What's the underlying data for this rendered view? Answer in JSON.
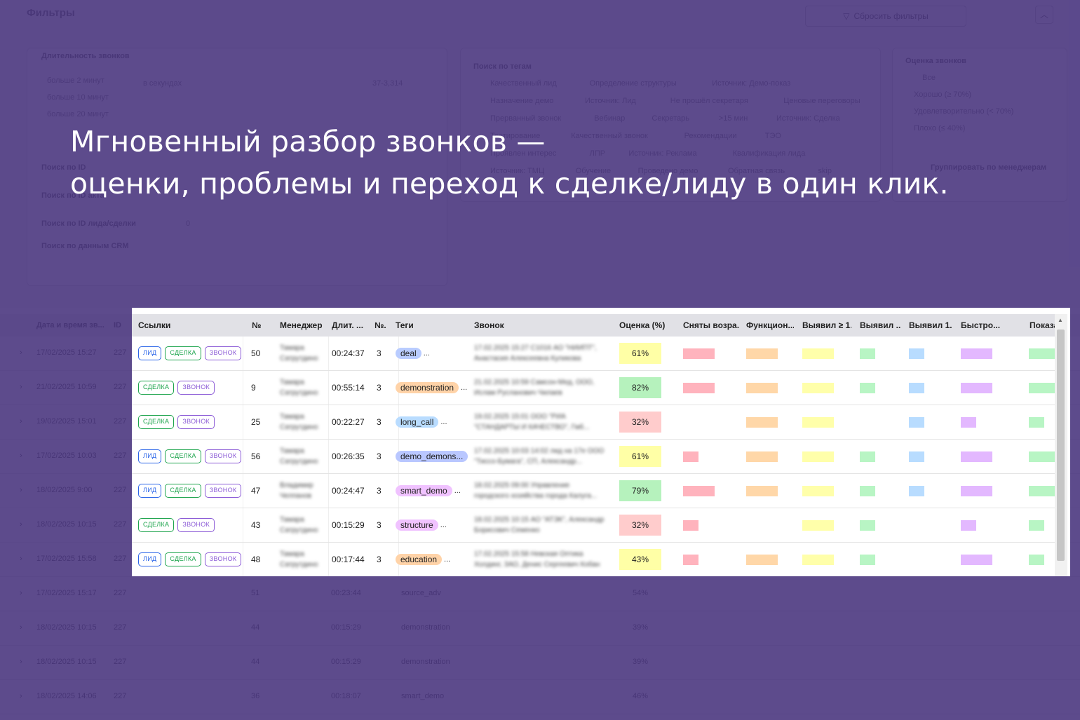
{
  "headline": {
    "line1": "Мгновенный разбор звонков —",
    "line2": "оценки, проблемы и переход к сделке/лиду в один клик."
  },
  "background": {
    "filters_title": "Фильтры",
    "reset_filters": "Сбросить фильтры",
    "duration_title": "Длительность звонков",
    "duration_options": [
      "больше 2 минут",
      "больше 10 минут",
      "больше 20 минут"
    ],
    "seconds_placeholder": "в секундах",
    "seconds_range": "37-3,314",
    "search_id": "Поиск по ID",
    "search_act": "Поиск по ID акта",
    "search_lead": "Поиск по ID лида/сделки",
    "search_lead_value": "0",
    "search_crm": "Поиск по данным CRM",
    "tags_title": "Поиск по тегам",
    "tags": [
      [
        "Качественный лид",
        "Определение структуры",
        "Источник: Демо-показ"
      ],
      [
        "Назначение демо",
        "Источник: Лид",
        "Не прошёл секретаря",
        "Ценовые переговоры"
      ],
      [
        "Прерванный звонок",
        "Вебинар",
        "Секретарь",
        ">15 мин",
        "Источник: Сделка"
      ],
      [
        "Тестирование",
        "Качественный звонок",
        "Рекомендации",
        "ТЭО"
      ],
      [
        "Проявлен интерес",
        "ЛПР",
        "Источник: Реклама",
        "Квалификация лида"
      ],
      [
        "Источник: ТМЦ",
        "Обучение",
        "Проведено демо",
        "Обратная связь",
        "skip"
      ]
    ],
    "rating_title": "Оценка звонков",
    "rating_options": [
      "Все",
      "Хорошо (≥ 70%)",
      "Удовлетворительно (< 70%)",
      "Плохо (≤ 40%)"
    ],
    "group_button": "Группировать по менеджерам",
    "table_head": [
      "Дата и время зв...",
      "ID"
    ],
    "rows": [
      {
        "date": "17/02/2025 15:27",
        "id": "227"
      },
      {
        "date": "21/02/2025 10:59",
        "id": "227"
      },
      {
        "date": "19/02/2025 15:01",
        "id": "227"
      },
      {
        "date": "17/02/2025 10:03",
        "id": "227"
      },
      {
        "date": "18/02/2025 9:00",
        "id": "227"
      },
      {
        "date": "18/02/2025 10:15",
        "id": "227"
      },
      {
        "date": "17/02/2025 15:58",
        "id": "227"
      },
      {
        "date": "17/02/2025 15:17",
        "id": "227",
        "num": "51",
        "dur": "00:23:44",
        "tag": "source_adv",
        "score": "54%"
      },
      {
        "date": "18/02/2025 10:15",
        "id": "227",
        "num": "44",
        "dur": "00:15:29",
        "tag": "demonstration",
        "score": "39%"
      },
      {
        "date": "18/02/2025 10:15",
        "id": "227",
        "num": "44",
        "dur": "00:15:29",
        "tag": "demonstration",
        "score": "39%"
      },
      {
        "date": "18/02/2025 14:06",
        "id": "227",
        "num": "36",
        "dur": "00:18:07",
        "tag": "smart_demo",
        "score": "46%"
      }
    ]
  },
  "table": {
    "columns": [
      "Ссылки",
      "№",
      "Менеджер",
      "Длит. ...",
      "№.",
      "Теги",
      "Звонок",
      "Оценка (%)",
      "Сняты возра...",
      "Функцион...",
      "Выявил ≥ 1...",
      "Выявил ...",
      "Выявил 1...",
      "Быстро...",
      "Показа..."
    ],
    "badge_labels": {
      "lead": "ЛИД",
      "deal": "СДЕЛКА",
      "call": "ЗВОНОК"
    },
    "bar_colors": [
      "#ffb3bd",
      "#ffd7a8",
      "#ffffaa",
      "#b8f5c4",
      "#b8dcff",
      "#e3b8ff",
      "#b8f5c4"
    ],
    "rows": [
      {
        "links": [
          "lead",
          "deal",
          "call"
        ],
        "num": "50",
        "manager": "Тамара Сатрутдино",
        "duration": "00:24:37",
        "n": "3",
        "tag": "deal",
        "tag_color": "#b9ccff",
        "call": "17.02.2025 15:27 С1016 АО \"НИИПТ\", Анастасия Алексеевна Куликова",
        "score": "61%",
        "score_color": "#ffffa6",
        "bars": [
          45,
          45,
          45,
          22,
          22,
          45,
          38
        ]
      },
      {
        "links": [
          "deal",
          "call"
        ],
        "num": "9",
        "manager": "Тамара Сатрутдино",
        "duration": "00:55:14",
        "n": "3",
        "tag": "demonstration",
        "tag_color": "#ffd3a8",
        "call": "21.02.2025 10:59 Самсон-Мед, ООО, Ислам Русланович Чилаев",
        "score": "82%",
        "score_color": "#b6f2bd",
        "bars": [
          45,
          45,
          45,
          22,
          22,
          45,
          38
        ]
      },
      {
        "links": [
          "deal",
          "call"
        ],
        "num": "25",
        "manager": "Тамара Сатрутдино",
        "duration": "00:22:27",
        "n": "3",
        "tag": "long_call",
        "tag_color": "#b9dcff",
        "call": "19.02.2025 15:01 ООО \"РИА \"СТАНДАРТЫ И КАЧЕСТВО\", Гмб...",
        "score": "32%",
        "score_color": "#ffcccc",
        "bars": [
          0,
          45,
          45,
          0,
          22,
          22,
          22
        ]
      },
      {
        "links": [
          "lead",
          "deal",
          "call"
        ],
        "num": "56",
        "manager": "Тамара Сатрутдино",
        "duration": "00:26:35",
        "n": "3",
        "tag": "demo_demons...",
        "tag_color": "#b9c7ff",
        "call": "17.02.2025 10:03 14:02 лид на 17е ООО \"Тиссо-Бумага\", СП, Александр...",
        "score": "61%",
        "score_color": "#ffffa6",
        "bars": [
          22,
          45,
          45,
          22,
          22,
          45,
          38
        ]
      },
      {
        "links": [
          "lead",
          "deal",
          "call"
        ],
        "num": "47",
        "manager": "Владимир Челпанов",
        "duration": "00:24:47",
        "n": "3",
        "tag": "smart_demo",
        "tag_color": "#f0c2ff",
        "call": "18.02.2025 09:00 Управление городского хозяйства города Калуга...",
        "score": "79%",
        "score_color": "#b6f2bd",
        "bars": [
          45,
          45,
          45,
          22,
          22,
          45,
          38
        ]
      },
      {
        "links": [
          "deal",
          "call"
        ],
        "num": "43",
        "manager": "Тамара Сатрутдино",
        "duration": "00:15:29",
        "n": "3",
        "tag": "structure",
        "tag_color": "#f0c2ff",
        "call": "18.02.2025 10:15 АО \"АТЭК\", Александр Борисович Семенко",
        "score": "32%",
        "score_color": "#ffcccc",
        "bars": [
          22,
          0,
          45,
          22,
          0,
          22,
          22
        ]
      },
      {
        "links": [
          "lead",
          "deal",
          "call"
        ],
        "num": "48",
        "manager": "Тамара Сатрутдино",
        "duration": "00:17:44",
        "n": "3",
        "tag": "education",
        "tag_color": "#ffd3a8",
        "call": "17.02.2025 15:58 Невская Оптика Холдинг, ЗАО, Денис Сергеевич Кобан",
        "score": "43%",
        "score_color": "#ffffa6",
        "bars": [
          22,
          45,
          45,
          22,
          0,
          45,
          22
        ]
      }
    ]
  }
}
